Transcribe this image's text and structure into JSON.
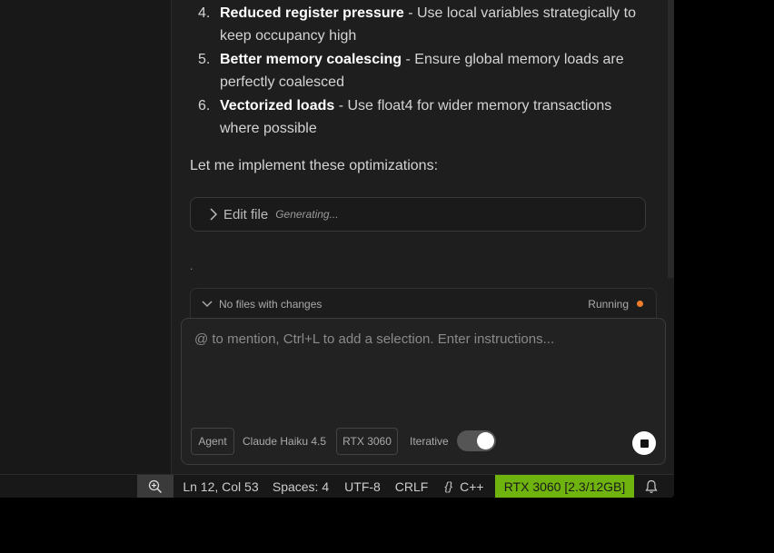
{
  "chat": {
    "steps": [
      {
        "num": "4.",
        "title": "Reduced register pressure",
        "desc": " - Use local variables strategically to",
        "cont": "keep occupancy high"
      },
      {
        "num": "5.",
        "title": "Better memory coalescing",
        "desc": " - Ensure global memory loads are",
        "cont": "perfectly coalesced"
      },
      {
        "num": "6.",
        "title": "Vectorized loads",
        "desc": " - Use float4 for wider memory transactions",
        "cont": "where possible"
      }
    ],
    "intro": "Let me implement these optimizations:",
    "edit_file": {
      "label": "Edit file",
      "status": "Generating..."
    },
    "dot": "."
  },
  "changes_bar": {
    "label": "No files with changes",
    "status": "Running",
    "status_color": "#f07d2c"
  },
  "composer": {
    "placeholder": "@ to mention, Ctrl+L to add a selection. Enter instructions...",
    "mode": "Agent",
    "model": "Claude Haiku 4.5",
    "gpu_chip": "RTX 3060",
    "iterative_label": "Iterative",
    "iterative_on": true
  },
  "statusbar": {
    "position": "Ln 12, Col 53",
    "spaces": "Spaces: 4",
    "encoding": "UTF-8",
    "eol": "CRLF",
    "language_icon": "{}",
    "language": "C++",
    "gpu": "RTX 3060 [2.3/12GB]",
    "gpu_color": "#6fb30e"
  }
}
